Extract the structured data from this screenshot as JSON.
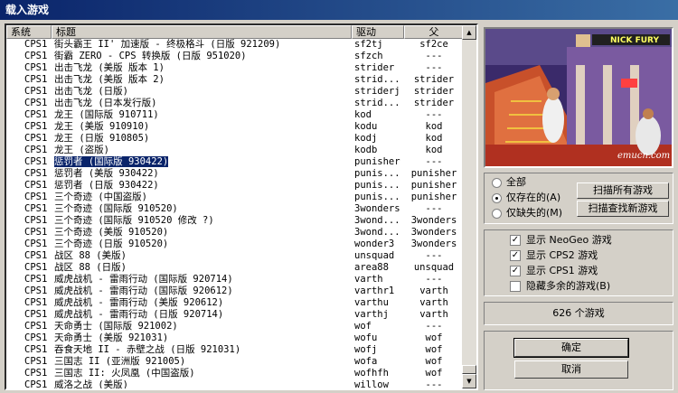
{
  "window": {
    "title": "载入游戏"
  },
  "columns": {
    "system": "系统",
    "title": "标题",
    "driver": "驱动",
    "parent": "父"
  },
  "rows": [
    {
      "sys": "CPS1",
      "title": "街头霸王 II' 加速版 - 终极格斗 (日版 921209)",
      "drv": "sf2tj",
      "par": "sf2ce"
    },
    {
      "sys": "CPS1",
      "title": "街霸 ZERO  - CPS 转换版 (日版 951020)",
      "drv": "sfzch",
      "par": "---"
    },
    {
      "sys": "CPS1",
      "title": "出击飞龙 (美版 版本 1)",
      "drv": "strider",
      "par": "---"
    },
    {
      "sys": "CPS1",
      "title": "出击飞龙 (美版 版本 2)",
      "drv": "strid...",
      "par": "strider"
    },
    {
      "sys": "CPS1",
      "title": "出击飞龙 (日版)",
      "drv": "striderj",
      "par": "strider"
    },
    {
      "sys": "CPS1",
      "title": "出击飞龙 (日本发行版)",
      "drv": "strid...",
      "par": "strider"
    },
    {
      "sys": "CPS1",
      "title": "龙王 (国际版 910711)",
      "drv": "kod",
      "par": "---"
    },
    {
      "sys": "CPS1",
      "title": "龙王 (美版 910910)",
      "drv": "kodu",
      "par": "kod"
    },
    {
      "sys": "CPS1",
      "title": "龙王 (日版 910805)",
      "drv": "kodj",
      "par": "kod"
    },
    {
      "sys": "CPS1",
      "title": "龙王 (盗版)",
      "drv": "kodb",
      "par": "kod"
    },
    {
      "sys": "CPS1",
      "title": "惩罚者 (国际版 930422)",
      "drv": "punisher",
      "par": "---",
      "selected": true
    },
    {
      "sys": "CPS1",
      "title": "惩罚者 (美版 930422)",
      "drv": "punis...",
      "par": "punisher"
    },
    {
      "sys": "CPS1",
      "title": "惩罚者 (日版 930422)",
      "drv": "punis...",
      "par": "punisher"
    },
    {
      "sys": "CPS1",
      "title": "三个奇迹 (中国盗版)",
      "drv": "punis...",
      "par": "punisher"
    },
    {
      "sys": "CPS1",
      "title": "三个奇迹 (国际版 910520)",
      "drv": "3wonders",
      "par": "---"
    },
    {
      "sys": "CPS1",
      "title": "三个奇迹 (国际版 910520 修改 ?)",
      "drv": "3wond...",
      "par": "3wonders"
    },
    {
      "sys": "CPS1",
      "title": "三个奇迹 (美版 910520)",
      "drv": "3wond...",
      "par": "3wonders"
    },
    {
      "sys": "CPS1",
      "title": "三个奇迹 (日版 910520)",
      "drv": "wonder3",
      "par": "3wonders"
    },
    {
      "sys": "CPS1",
      "title": "战区 88 (美版)",
      "drv": "unsquad",
      "par": "---"
    },
    {
      "sys": "CPS1",
      "title": "战区 88 (日版)",
      "drv": "area88",
      "par": "unsquad"
    },
    {
      "sys": "CPS1",
      "title": "威虎战机 - 雷雨行动 (国际版 920714)",
      "drv": "varth",
      "par": "---"
    },
    {
      "sys": "CPS1",
      "title": "威虎战机 - 雷雨行动 (国际版 920612)",
      "drv": "varthr1",
      "par": "varth"
    },
    {
      "sys": "CPS1",
      "title": "威虎战机 - 雷雨行动 (美版 920612)",
      "drv": "varthu",
      "par": "varth"
    },
    {
      "sys": "CPS1",
      "title": "威虎战机 - 雷雨行动 (日版 920714)",
      "drv": "varthj",
      "par": "varth"
    },
    {
      "sys": "CPS1",
      "title": "天命勇士 (国际版 921002)",
      "drv": "wof",
      "par": "---"
    },
    {
      "sys": "CPS1",
      "title": "天命勇士 (美版 921031)",
      "drv": "wofu",
      "par": "wof"
    },
    {
      "sys": "CPS1",
      "title": "吞食天地 II - 赤壁之战 (日版 921031)",
      "drv": "wofj",
      "par": "wof"
    },
    {
      "sys": "CPS1",
      "title": "三国志 II (亚洲版 921005)",
      "drv": "wofa",
      "par": "wof"
    },
    {
      "sys": "CPS1",
      "title": "三国志 II: 火凤凰 (中国盗版)",
      "drv": "wofhfh",
      "par": "wof"
    },
    {
      "sys": "CPS1",
      "title": "威洛之战 (美版)",
      "drv": "willow",
      "par": "---"
    }
  ],
  "preview": {
    "hud_text": "NICK FURY",
    "watermark": "emucn.com"
  },
  "filter": {
    "options": [
      {
        "label": "全部",
        "checked": false
      },
      {
        "label": "仅存在的(A)",
        "checked": true
      },
      {
        "label": "仅缺失的(M)",
        "checked": false
      }
    ],
    "scan_all": "扫描所有游戏",
    "scan_new": "扫描查找新游戏"
  },
  "display": {
    "items": [
      {
        "label": "显示 NeoGeo 游戏",
        "checked": true
      },
      {
        "label": "显示 CPS2 游戏",
        "checked": true
      },
      {
        "label": "显示 CPS1 游戏",
        "checked": true
      },
      {
        "label": "隐藏多余的游戏(B)",
        "checked": false
      }
    ]
  },
  "count_text": "626 个游戏",
  "buttons": {
    "ok": "确定",
    "cancel": "取消"
  },
  "colors": {
    "titlebar": "#0a246a",
    "selection": "#0a246a",
    "face": "#d4d0c8"
  }
}
